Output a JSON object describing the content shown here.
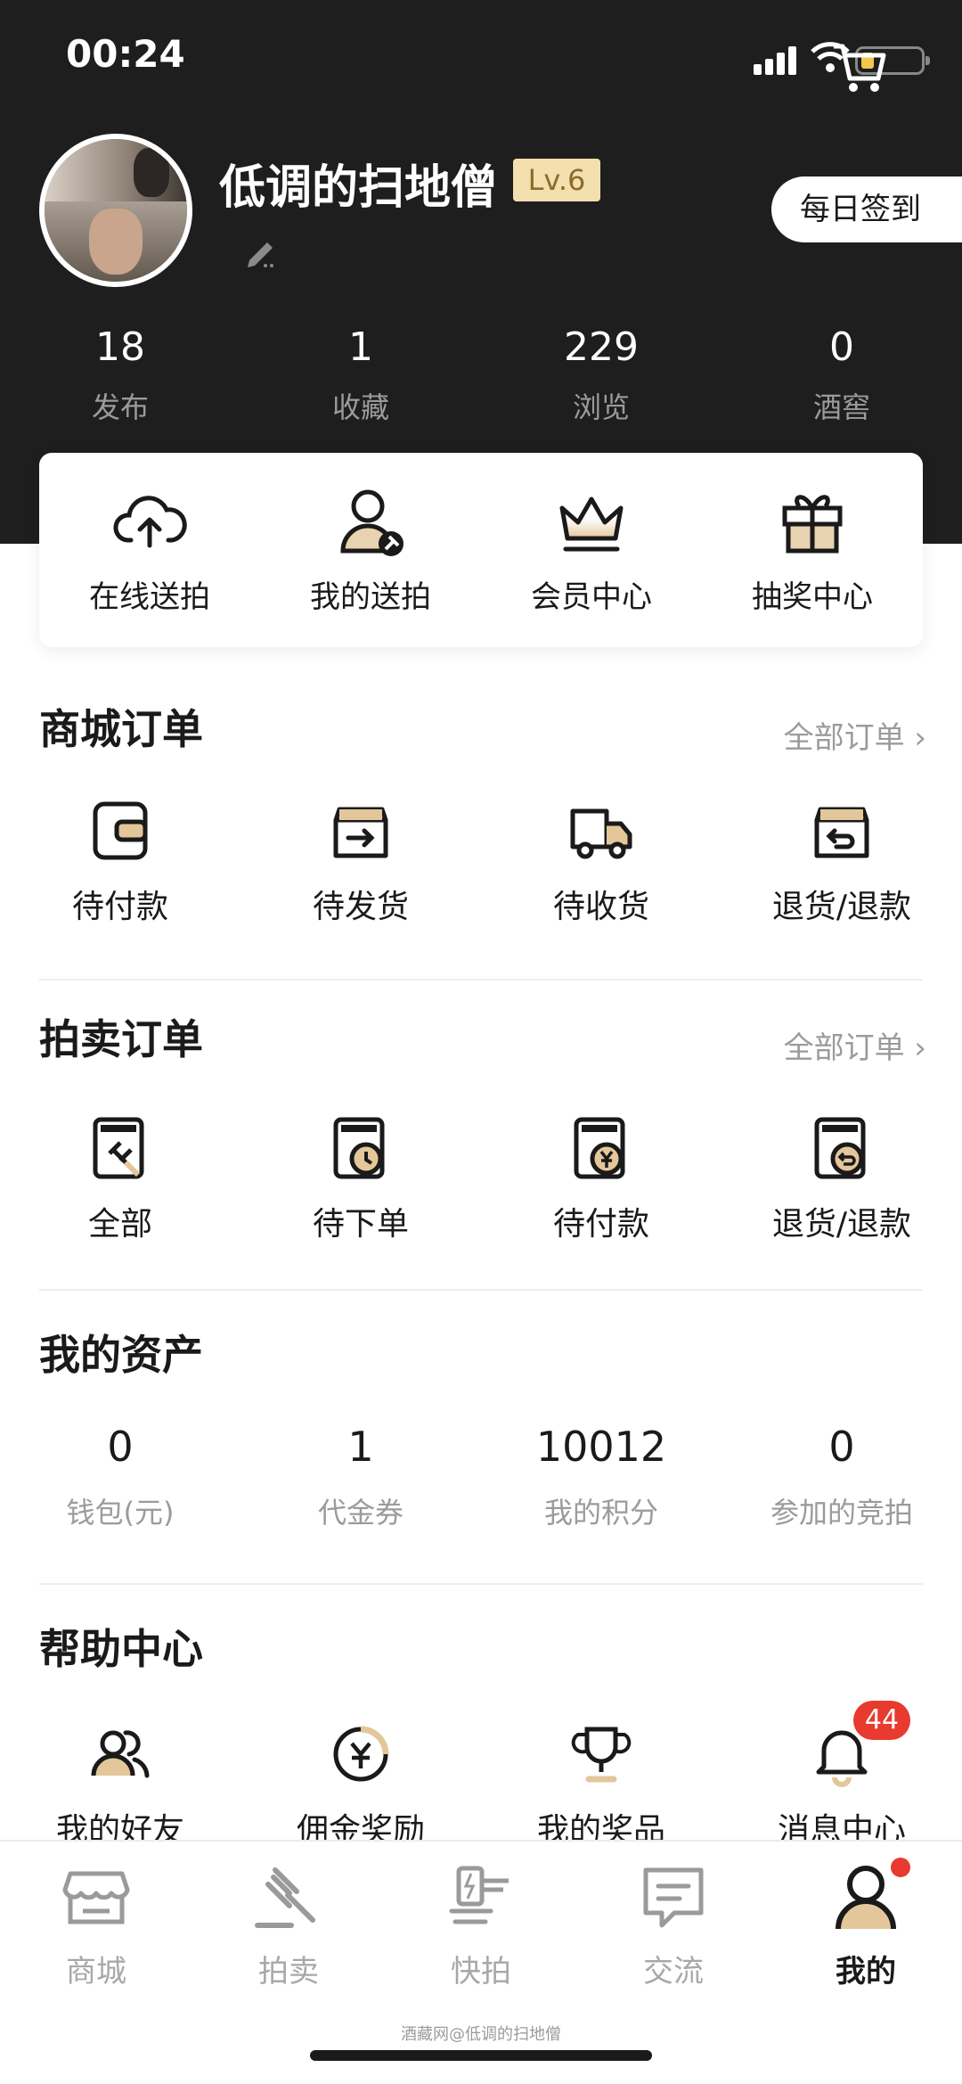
{
  "status_bar": {
    "time": "00:24"
  },
  "profile": {
    "username": "低调的扫地僧",
    "level": "Lv.6",
    "checkin_label": "每日签到"
  },
  "stats": [
    {
      "value": "18",
      "label": "发布"
    },
    {
      "value": "1",
      "label": "收藏"
    },
    {
      "value": "229",
      "label": "浏览"
    },
    {
      "value": "0",
      "label": "酒窖"
    }
  ],
  "quick_actions": [
    {
      "label": "在线送拍",
      "icon": "cloud-upload-icon"
    },
    {
      "label": "我的送拍",
      "icon": "user-auction-icon"
    },
    {
      "label": "会员中心",
      "icon": "crown-icon"
    },
    {
      "label": "抽奖中心",
      "icon": "gift-icon"
    }
  ],
  "mall_orders": {
    "title": "商城订单",
    "more": "全部订单 ›",
    "items": [
      {
        "label": "待付款",
        "icon": "wallet-icon"
      },
      {
        "label": "待发货",
        "icon": "box-ship-icon"
      },
      {
        "label": "待收货",
        "icon": "truck-icon"
      },
      {
        "label": "退货/退款",
        "icon": "box-return-icon"
      }
    ]
  },
  "auction_orders": {
    "title": "拍卖订单",
    "more": "全部订单 ›",
    "items": [
      {
        "label": "全部",
        "icon": "auction-all-icon"
      },
      {
        "label": "待下单",
        "icon": "auction-clock-icon"
      },
      {
        "label": "待付款",
        "icon": "auction-yen-icon"
      },
      {
        "label": "退货/退款",
        "icon": "auction-return-icon"
      }
    ]
  },
  "assets": {
    "title": "我的资产",
    "items": [
      {
        "value": "0",
        "label": "钱包(元)"
      },
      {
        "value": "1",
        "label": "代金券"
      },
      {
        "value": "10012",
        "label": "我的积分"
      },
      {
        "value": "0",
        "label": "参加的竞拍"
      }
    ]
  },
  "help": {
    "title": "帮助中心",
    "items": [
      {
        "label": "我的好友",
        "icon": "friends-icon"
      },
      {
        "label": "佣金奖励",
        "icon": "commission-icon"
      },
      {
        "label": "我的奖品",
        "icon": "trophy-icon"
      },
      {
        "label": "消息中心",
        "icon": "bell-icon"
      }
    ],
    "message_badge": "44"
  },
  "tabbar": [
    {
      "label": "商城",
      "icon": "shop-icon",
      "active": false
    },
    {
      "label": "拍卖",
      "icon": "gavel-icon",
      "active": false
    },
    {
      "label": "快拍",
      "icon": "quick-auction-icon",
      "active": false
    },
    {
      "label": "交流",
      "icon": "chat-icon",
      "active": false
    },
    {
      "label": "我的",
      "icon": "profile-icon",
      "active": true
    }
  ],
  "watermark": "酒藏网@低调的扫地僧",
  "colors": {
    "header_bg": "#1e1e1e",
    "gold": "#c9a063",
    "badge_red": "#e83a2e",
    "level_bg": "#f4dfae"
  }
}
